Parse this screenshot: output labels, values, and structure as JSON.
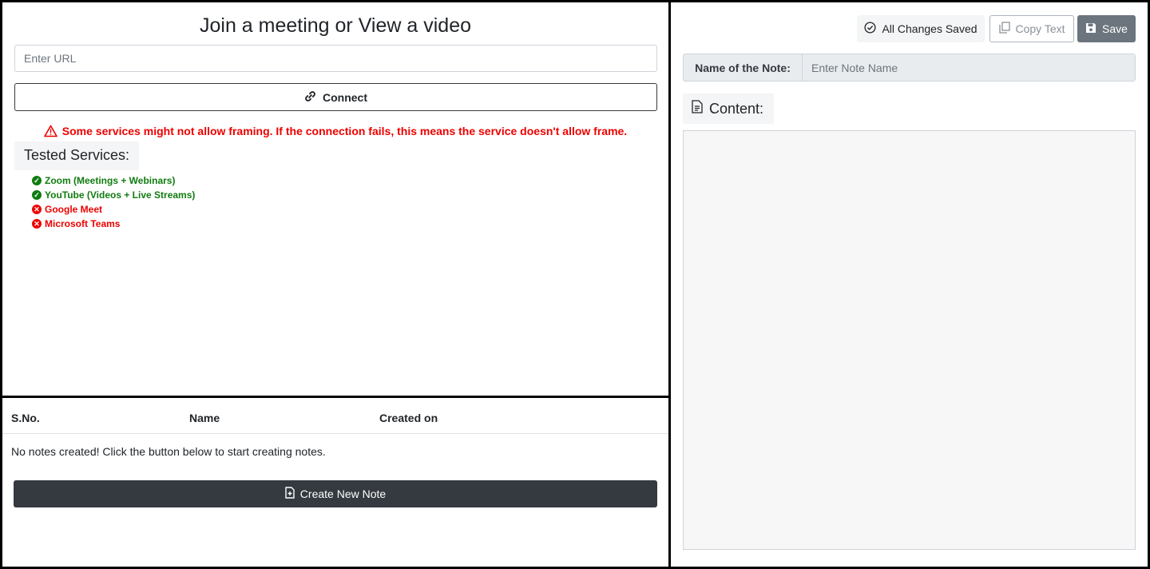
{
  "join": {
    "title": "Join a meeting or View a video",
    "url_placeholder": "Enter URL",
    "connect_label": "Connect",
    "warning": "Some services might not allow framing. If the connection fails, this means the service doesn't allow frame."
  },
  "tested": {
    "heading": "Tested Services:",
    "services": [
      {
        "label": "Zoom (Meetings + Webinars)",
        "status": "supported"
      },
      {
        "label": "YouTube (Videos + Live Streams)",
        "status": "supported"
      },
      {
        "label": "Google Meet",
        "status": "unsupported"
      },
      {
        "label": "Microsoft Teams",
        "status": "unsupported"
      }
    ]
  },
  "notes_table": {
    "columns": [
      "S.No.",
      "Name",
      "Created on"
    ],
    "empty_message": "No notes created! Click the button below to start creating notes.",
    "create_label": "Create New Note"
  },
  "editor": {
    "saved_status": "All Changes Saved",
    "copy_label": "Copy Text",
    "save_label": "Save",
    "name_label": "Name of the Note:",
    "name_placeholder": "Enter Note Name",
    "content_heading": "Content:"
  },
  "colors": {
    "success": "#107c10",
    "danger": "#ee0000",
    "dark_button": "#343a40",
    "secondary_button": "#6c757d"
  },
  "icons": {
    "connect": "link-icon",
    "warning": "warning-triangle-icon",
    "supported": "check-circle-icon",
    "unsupported": "x-circle-icon",
    "create": "file-plus-icon",
    "saved": "check-circle-outline-icon",
    "copy": "copy-icon",
    "save": "floppy-disk-icon",
    "content": "document-icon"
  }
}
